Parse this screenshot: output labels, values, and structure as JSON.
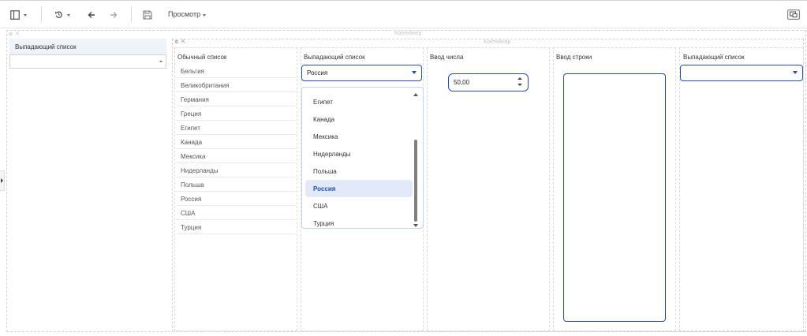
{
  "toolbar": {
    "preview_label": "Просмотр",
    "icons": [
      "panel-layout-icon",
      "history-icon",
      "arrow-left-icon",
      "arrow-right-icon",
      "save-icon",
      "device-preview-icon"
    ]
  },
  "canvas": {
    "outer_container_label": "Контейнер",
    "inner_container_label": "Контейнер"
  },
  "sidebar": {
    "dropdown_title": "Выпадающий список",
    "dropdown_value": ""
  },
  "plain_list": {
    "title": "Обычный список",
    "items": [
      "Бельгия",
      "Великобритания",
      "Германия",
      "Греция",
      "Египет",
      "Канада",
      "Мексика",
      "Нидерланды",
      "Польша",
      "Россия",
      "США",
      "Турция"
    ]
  },
  "dropdown": {
    "title": "Выпадающий список",
    "selected": "Россия",
    "visible_options": [
      "Египет",
      "Канада",
      "Мексика",
      "Нидерланды",
      "Польша",
      "Россия",
      "США",
      "Турция"
    ]
  },
  "number_input": {
    "title": "Ввод числа",
    "value": "50,00"
  },
  "string_input": {
    "title": "Ввод строки",
    "value": ""
  },
  "right_dropdown": {
    "title": "Выпадающий список",
    "value": ""
  },
  "colors": {
    "accent": "#1e4fb8",
    "selected_bg": "#e2eafa"
  }
}
